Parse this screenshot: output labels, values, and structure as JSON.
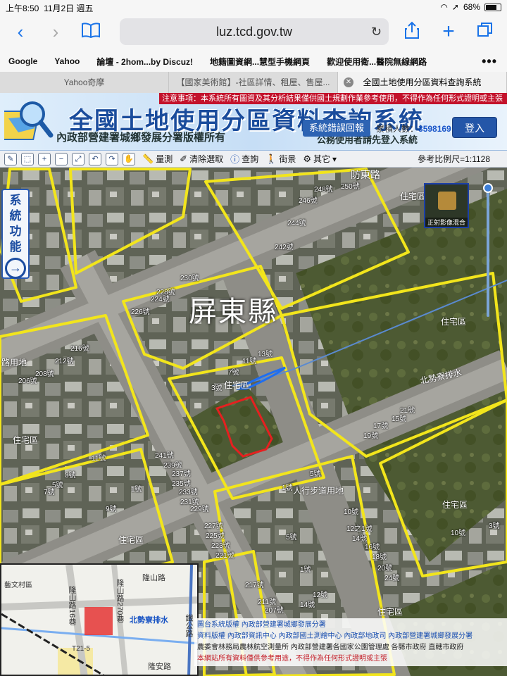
{
  "status": {
    "time": "上午8:50",
    "date": "11月2日 週五",
    "battery": "68%"
  },
  "browser": {
    "url": "luz.tcd.gov.tw",
    "bookmarks": [
      "Google",
      "Yahoo",
      "論壇 - 2hom...by Discuz!",
      "地籍圖資網...慧型手機網頁",
      "歡迎使用衛...醫院無線網路"
    ],
    "tabs": [
      "Yahoo奇摩",
      "【國家美術館】-社區詳情、租屋、售屋...",
      "全國土地使用分區資料查詢系統"
    ]
  },
  "site": {
    "notice": "注意事項：本系統所有圖資及其分析結果僅供國土規劃作業參考使用，不得作為任何形式證明或主張",
    "title": "全國土地使用分區資料查詢系統",
    "owner": "內政部營建署城鄉發展分署版權所有",
    "subtitle": "公務使用者請先登入系統",
    "report_button": "系統錯誤回報",
    "visit_label": "累積人數：",
    "visit_count": "3598169",
    "login_button": "登入"
  },
  "toolbar": {
    "measure": "量測",
    "clear": "清除選取",
    "query": "查詢",
    "streetview": "街景",
    "other": "其它",
    "scale": "參考比例尺=1:1128"
  },
  "map": {
    "system_function": "系統功能",
    "ortho_label": "正射影像混合",
    "zoom_level": 0,
    "county": "屏東縣",
    "zones": [
      "住宅區",
      "住宅區",
      "住宅區",
      "住宅區",
      "住宅區",
      "住宅區",
      "住宅區"
    ],
    "labels": {
      "sidewalk": "人行步道用地",
      "drain": "北勢寮排水",
      "road_use": "路用地",
      "top_road": "防東路"
    },
    "house_numbers": [
      "248號",
      "250號",
      "246號",
      "244號",
      "242號",
      "230號",
      "228號",
      "226號",
      "224號",
      "13號",
      "11號",
      "7號",
      "3號",
      "5號",
      "216號",
      "212號",
      "208號",
      "206號",
      "241號",
      "239號",
      "237號",
      "235號",
      "233號",
      "231號",
      "229號",
      "227號",
      "225號",
      "223號",
      "221號",
      "217號",
      "211號",
      "207號",
      "205號",
      "19號",
      "17號",
      "15號",
      "21號",
      "10號",
      "12之1號",
      "14號",
      "16號",
      "18號",
      "20號",
      "24號",
      "3號",
      "5號",
      "7號",
      "9號",
      "11號",
      "1號",
      "1號",
      "5號",
      "1號",
      "12號",
      "14號",
      "10號",
      "3號"
    ],
    "copyright_lines": [
      "圖台系統版權 內政部營建署城鄉發展分署",
      "資料版權 內政部資訊中心 內政部國土測繪中心 內政部地政司 內政部營建署城鄉發展分署",
      "農委會林務局農林航空測量所 內政部營建署各國家公園管理處 各縣市政府 直轄市政府",
      "本網站所有資料僅供參考用途，不得作為任何形式證明或主張"
    ],
    "minimap": {
      "roads": [
        "隆山路",
        "隆山路16巷",
        "隆山路270巷",
        "北勢寮排水",
        "鐵公路",
        "隆安路",
        "公路",
        "藝文村區",
        "T21-5"
      ]
    }
  }
}
